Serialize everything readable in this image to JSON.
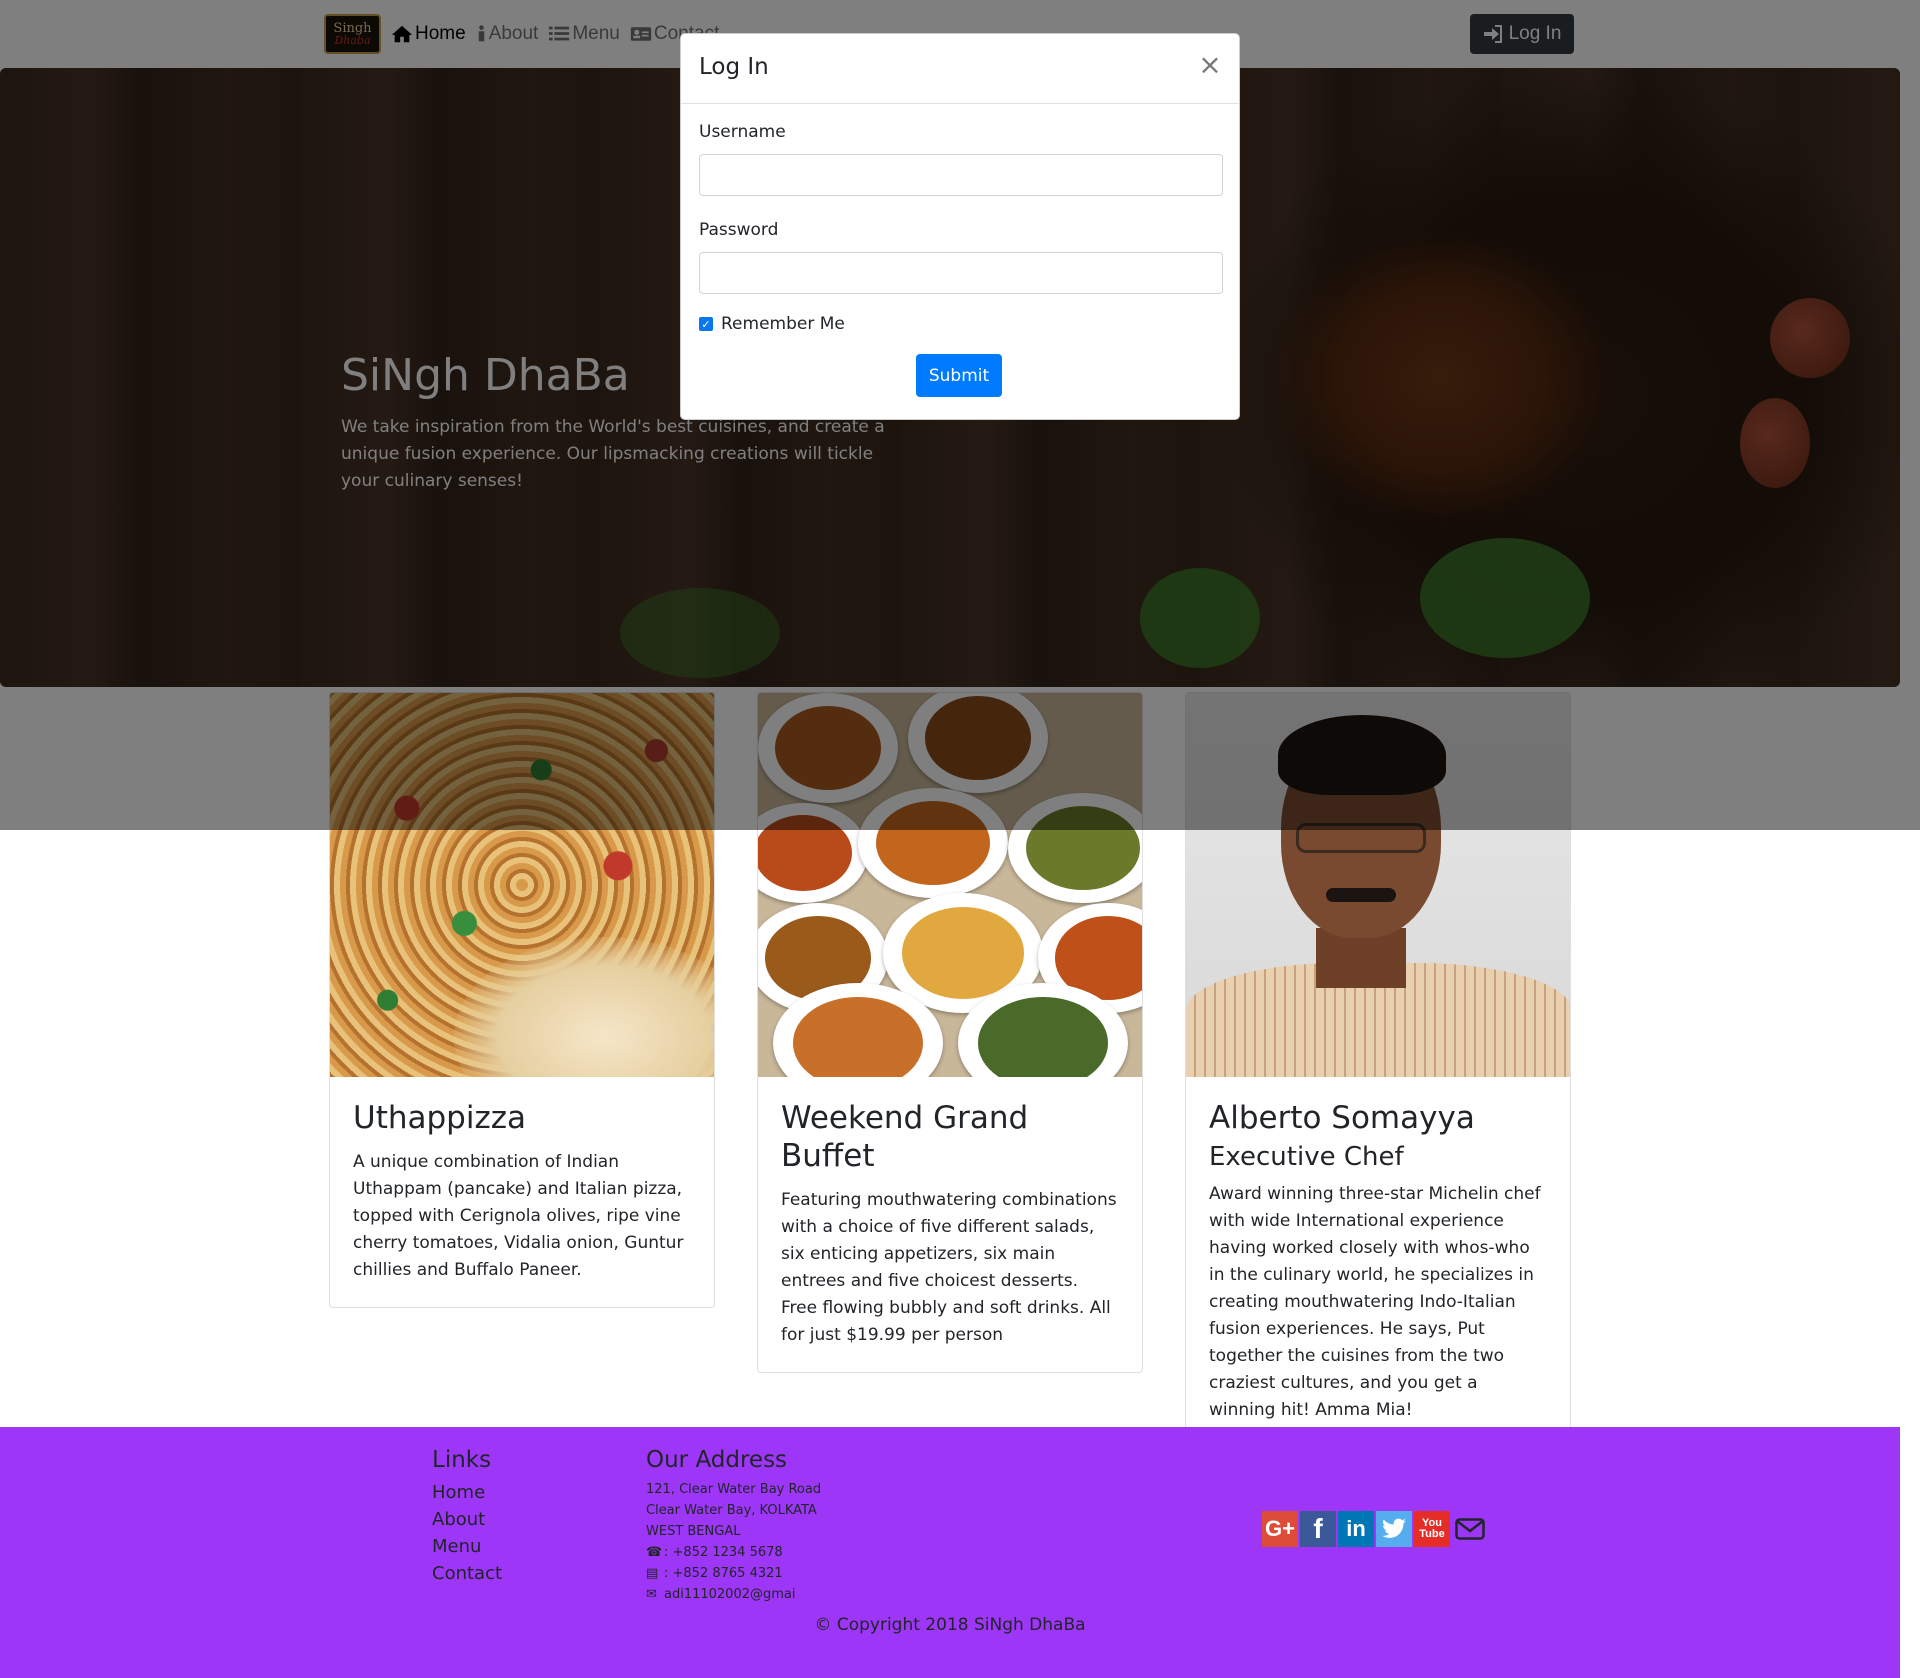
{
  "navbar": {
    "brand_line1": "Singh",
    "brand_line2": "Dhaba",
    "links": [
      {
        "label": "Home",
        "icon": "home-icon"
      },
      {
        "label": "About",
        "icon": "info-icon"
      },
      {
        "label": "Menu",
        "icon": "list-icon"
      },
      {
        "label": "Contact",
        "icon": "address-card-icon"
      }
    ],
    "login_label": "Log In"
  },
  "jumbotron": {
    "title": "SiNgh DhaBa",
    "text": "We take inspiration from the World's best cuisines, and create a unique fusion experience. Our lipsmacking creations will tickle your culinary senses!"
  },
  "cards": [
    {
      "title": "Uthappizza",
      "subtitle": "",
      "text": "A unique combination of Indian Uthappam (pancake) and Italian pizza, topped with Cerignola olives, ripe vine cherry tomatoes, Vidalia onion, Guntur chillies and Buffalo Paneer."
    },
    {
      "title": "Weekend Grand Buffet",
      "subtitle": "",
      "text": "Featuring mouthwatering combinations with a choice of five different salads, six enticing appetizers, six main entrees and five choicest desserts. Free flowing bubbly and soft drinks. All for just $19.99 per person"
    },
    {
      "title": "Alberto Somayya",
      "subtitle": "Executive Chef",
      "text": "Award winning three-star Michelin chef with wide International experience having worked closely with whos-who in the culinary world, he specializes in creating mouthwatering Indo-Italian fusion experiences. He says, Put together the cuisines from the two craziest cultures, and you get a winning hit! Amma Mia!"
    }
  ],
  "footer": {
    "links_heading": "Links",
    "links": [
      "Home",
      "About",
      "Menu",
      "Contact"
    ],
    "address_heading": "Our Address",
    "address_lines": [
      "121, Clear Water Bay Road",
      "Clear Water Bay, KOLKATA",
      "WEST BENGAL"
    ],
    "phone": ": +852 1234 5678",
    "fax": ": +852 8765 4321",
    "email": "adi11102002@gmai",
    "socials": [
      "google-plus-icon",
      "facebook-icon",
      "linkedin-icon",
      "twitter-icon",
      "youtube-icon",
      "envelope-icon"
    ],
    "copyright": "© Copyright 2018 SiNgh DhaBa"
  },
  "modal": {
    "title": "Log In",
    "close_glyph": "×",
    "username_label": "Username",
    "username_value": "",
    "password_label": "Password",
    "password_value": "",
    "remember_label": "Remember Me",
    "remember_checked": true,
    "submit_label": "Submit"
  },
  "colors": {
    "footer_bg": "#9d36f7",
    "primary": "#007bff",
    "dark_button": "#343a40"
  }
}
